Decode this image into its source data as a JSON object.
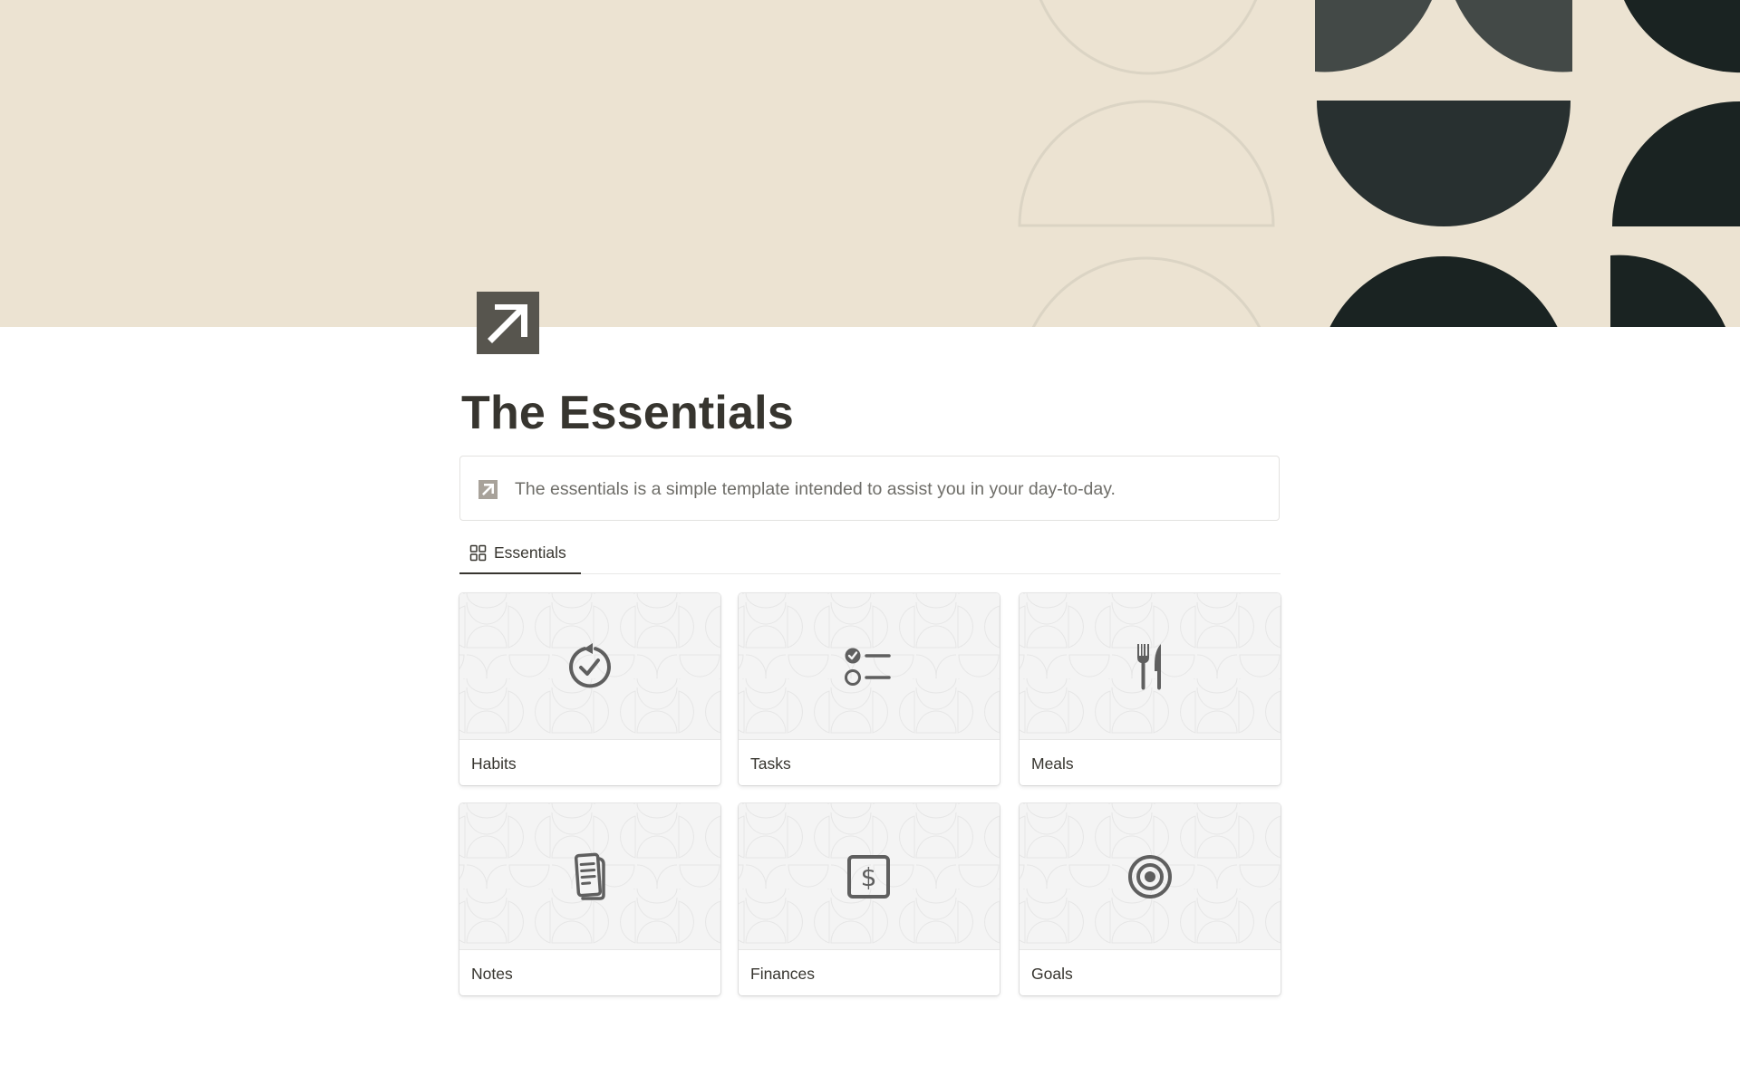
{
  "page": {
    "title": "The Essentials",
    "icon": "arrow-up-right-icon",
    "cover": {
      "background": "#ece3d2",
      "outline_color": "#dbd4c4",
      "dark_color_1": "#434947",
      "dark_color_2": "#283030",
      "dark_color_3": "#1a2322"
    }
  },
  "callout": {
    "icon": "arrow-up-right-icon",
    "text": "The essentials is a simple template intended to assist you in your day-to-day."
  },
  "views": {
    "tabs": [
      {
        "label": "Essentials",
        "icon": "gallery-grid-icon",
        "active": true
      }
    ]
  },
  "gallery": {
    "cards": [
      {
        "label": "Habits",
        "icon": "habit-repeat-check-icon"
      },
      {
        "label": "Tasks",
        "icon": "checklist-icon"
      },
      {
        "label": "Meals",
        "icon": "fork-knife-icon"
      },
      {
        "label": "Notes",
        "icon": "document-icon"
      },
      {
        "label": "Finances",
        "icon": "dollar-icon"
      },
      {
        "label": "Goals",
        "icon": "target-icon"
      }
    ]
  }
}
